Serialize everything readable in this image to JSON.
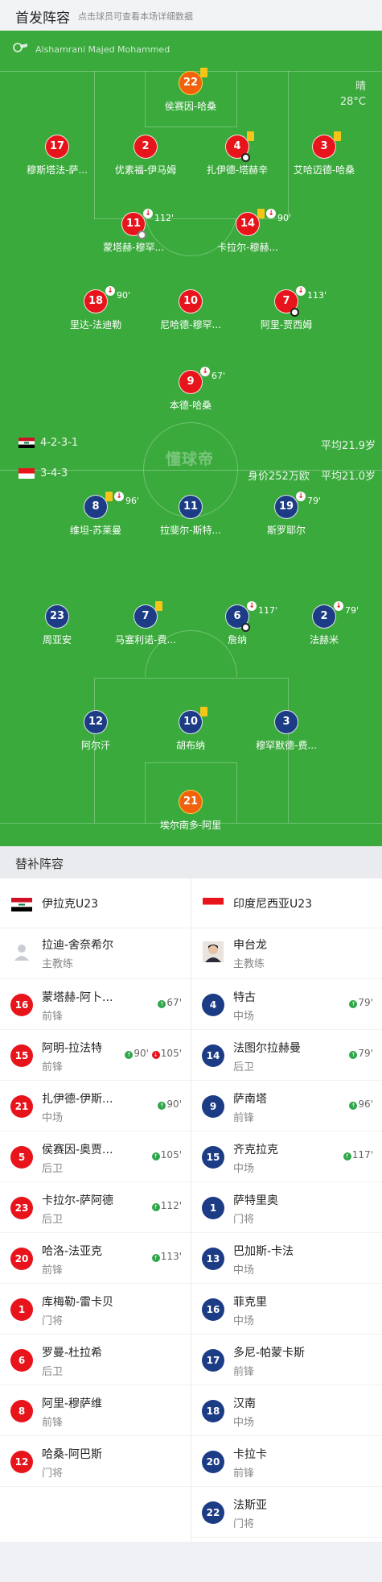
{
  "header": {
    "title": "首发阵容",
    "subtitle": "点击球员可查看本场详细数据"
  },
  "pitch": {
    "referee": "Alshamrani Majed Mohammed",
    "weather": "晴",
    "temperature": "28°C",
    "logo_text": "懂球帝",
    "home": {
      "formation": "4-2-3-1",
      "avg_age": "平均21.9岁"
    },
    "away": {
      "formation": "3-4-3",
      "value": "身价252万欧",
      "avg_age": "平均21.0岁"
    },
    "colors": {
      "home": "#e8141b",
      "away": "#1d3c86",
      "goalkeeper_home": "#f2620d",
      "pitch": "#3aaa3c"
    },
    "players_home": [
      {
        "num": "22",
        "name": "侯赛因-哈桑",
        "yellow": true
      },
      {
        "num": "17",
        "name": "穆斯塔法-萨..."
      },
      {
        "num": "2",
        "name": "优素福-伊马姆"
      },
      {
        "num": "4",
        "name": "扎伊德-塔赫辛",
        "yellow": true,
        "goal": true
      },
      {
        "num": "3",
        "name": "艾哈迈德-哈桑",
        "yellow": true
      },
      {
        "num": "11",
        "name": "蒙塔赫-穆罕...",
        "sub_time": "112'",
        "assist": true
      },
      {
        "num": "14",
        "name": "卡拉尔-穆赫...",
        "yellow": true,
        "sub_time": "90'"
      },
      {
        "num": "18",
        "name": "里达-法迪勒",
        "sub_time": "90'"
      },
      {
        "num": "10",
        "name": "尼哈德-穆罕..."
      },
      {
        "num": "7",
        "name": "阿里-贾西姆",
        "sub_time": "113'",
        "goal": true
      },
      {
        "num": "9",
        "name": "本德-哈桑",
        "sub_time": "67'"
      }
    ],
    "players_away": [
      {
        "num": "8",
        "name": "维坦-苏莱曼",
        "yellow": true,
        "sub_time": "96'"
      },
      {
        "num": "11",
        "name": "拉斐尔-斯特..."
      },
      {
        "num": "19",
        "name": "斯罗耶尔",
        "sub_time": "79'"
      },
      {
        "num": "23",
        "name": "周亚安"
      },
      {
        "num": "7",
        "name": "马塞利诺-费...",
        "yellow": true
      },
      {
        "num": "6",
        "name": "詹纳",
        "sub_time": "117'",
        "goal": true
      },
      {
        "num": "2",
        "name": "法赫米",
        "sub_time": "79'"
      },
      {
        "num": "12",
        "name": "阿尔汗"
      },
      {
        "num": "10",
        "name": "胡布纳",
        "yellow": true
      },
      {
        "num": "3",
        "name": "穆罕默德-费..."
      },
      {
        "num": "21",
        "name": "埃尔南多-阿里"
      }
    ]
  },
  "subs": {
    "title": "替补阵容",
    "home": {
      "team": "伊拉克U23",
      "coach": {
        "name": "拉迪-舍奈希尔",
        "role": "主教练"
      },
      "players": [
        {
          "num": "16",
          "name": "蒙塔赫-阿卜...",
          "pos": "前锋",
          "in": "67'"
        },
        {
          "num": "15",
          "name": "阿明-拉法特",
          "pos": "前锋",
          "in": "90'",
          "out": "105'"
        },
        {
          "num": "21",
          "name": "扎伊德-伊斯...",
          "pos": "中场",
          "in": "90'"
        },
        {
          "num": "5",
          "name": "侯赛因-奥贾...",
          "pos": "后卫",
          "in": "105'"
        },
        {
          "num": "23",
          "name": "卡拉尔-萨阿德",
          "pos": "后卫",
          "in": "112'"
        },
        {
          "num": "20",
          "name": "哈洛-法亚克",
          "pos": "前锋",
          "in": "113'"
        },
        {
          "num": "1",
          "name": "库梅勒-雷卡贝",
          "pos": "门将"
        },
        {
          "num": "6",
          "name": "罗曼-杜拉希",
          "pos": "后卫"
        },
        {
          "num": "8",
          "name": "阿里-穆萨维",
          "pos": "前锋"
        },
        {
          "num": "12",
          "name": "哈桑-阿巴斯",
          "pos": "门将"
        }
      ]
    },
    "away": {
      "team": "印度尼西亚U23",
      "coach": {
        "name": "申台龙",
        "role": "主教练"
      },
      "players": [
        {
          "num": "4",
          "name": "特古",
          "pos": "中场",
          "in": "79'"
        },
        {
          "num": "14",
          "name": "法图尔拉赫曼",
          "pos": "后卫",
          "in": "79'"
        },
        {
          "num": "9",
          "name": "萨南塔",
          "pos": "前锋",
          "in": "96'"
        },
        {
          "num": "15",
          "name": "齐克拉克",
          "pos": "中场",
          "in": "117'"
        },
        {
          "num": "1",
          "name": "萨特里奥",
          "pos": "门将"
        },
        {
          "num": "13",
          "name": "巴加斯-卡法",
          "pos": "中场"
        },
        {
          "num": "16",
          "name": "菲克里",
          "pos": "中场"
        },
        {
          "num": "17",
          "name": "多尼-帕蒙卡斯",
          "pos": "前锋"
        },
        {
          "num": "18",
          "name": "汉南",
          "pos": "中场"
        },
        {
          "num": "20",
          "name": "卡拉卡",
          "pos": "前锋"
        },
        {
          "num": "22",
          "name": "法斯亚",
          "pos": "门将"
        }
      ]
    }
  }
}
